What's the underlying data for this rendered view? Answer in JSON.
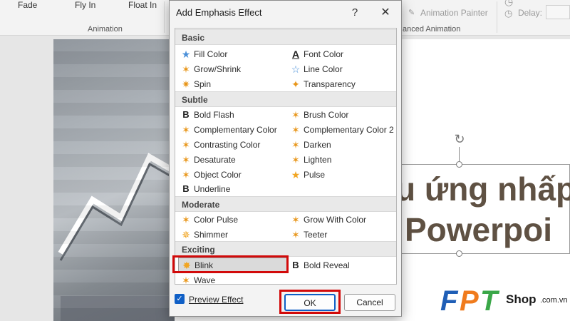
{
  "ribbon": {
    "fade": "Fade",
    "fly_in": "Fly In",
    "float_in": "Float In",
    "group_animation": "Animation",
    "group_advanced": "anced Animation",
    "animation_painter": "Animation Painter",
    "delay": "Delay:"
  },
  "dialog": {
    "title": "Add Emphasis Effect",
    "help": "?",
    "close": "✕",
    "categories": {
      "basic": "Basic",
      "subtle": "Subtle",
      "moderate": "Moderate",
      "exciting": "Exciting"
    },
    "basic": [
      "Fill Color",
      "Font Color",
      "Grow/Shrink",
      "Line Color",
      "Spin",
      "Transparency"
    ],
    "subtle": [
      "Bold Flash",
      "Brush Color",
      "Complementary Color",
      "Complementary Color 2",
      "Contrasting Color",
      "Darken",
      "Desaturate",
      "Lighten",
      "Object Color",
      "Pulse",
      "Underline"
    ],
    "moderate": [
      "Color Pulse",
      "Grow With Color",
      "Shimmer",
      "Teeter"
    ],
    "exciting": [
      "Blink",
      "Bold Reveal",
      "Wave"
    ],
    "preview_label": "Preview Effect",
    "preview_checked": true,
    "ok": "OK",
    "cancel": "Cancel",
    "selected": "Blink"
  },
  "slide": {
    "line1": "u ứng nhấp",
    "line2": "Powerpoi"
  },
  "logo": {
    "brand_letters": [
      "F",
      "P",
      "T"
    ],
    "shop": "Shop",
    "domain": ".com.vn"
  },
  "colors": {
    "accent_blue": "#0f5fc6",
    "highlight_red": "#d20a0a",
    "slide_text": "#5f5143",
    "logo_blue": "#1f5eb6"
  },
  "icons": {
    "effect_star": "star-icon",
    "bold_effect": "bold-b-icon",
    "font_color": "font-color-a-icon"
  }
}
